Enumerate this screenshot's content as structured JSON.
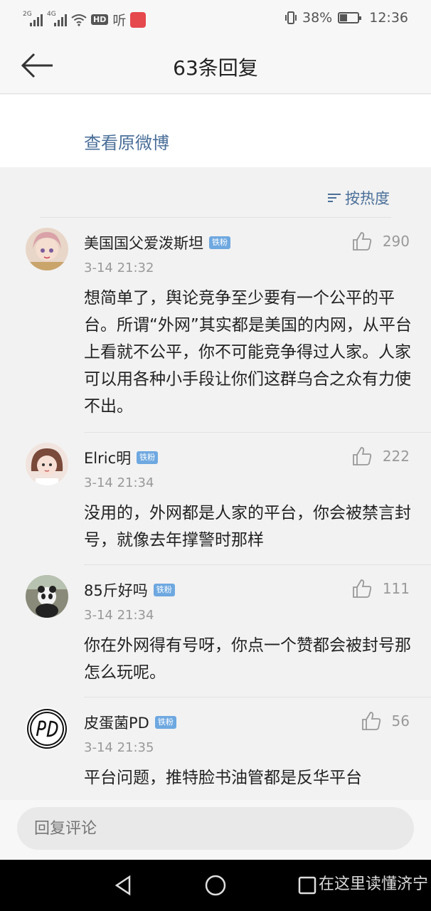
{
  "status_bar": {
    "net1": "2G",
    "net2": "4G",
    "hd": "HD",
    "listen": "听",
    "battery": "38%",
    "time": "12:36"
  },
  "header": {
    "title": "63条回复"
  },
  "original_link": "查看原微博",
  "sort_label": "按热度",
  "comments": [
    {
      "user": "美国国父爱泼斯坦",
      "badge": "铁粉",
      "likes": "290",
      "time": "3-14 21:32",
      "text": "想简单了，舆论竞争至少要有一个公平的平台。所谓“外网”其实都是美国的内网，从平台上看就不公平，你不可能竞争得过人家。人家可以用各种小手段让你们这群乌合之众有力使不出。"
    },
    {
      "user": "Elric明",
      "badge": "铁粉",
      "likes": "222",
      "time": "3-14 21:34",
      "text": "没用的，外网都是人家的平台，你会被禁言封号，就像去年撑警时那样"
    },
    {
      "user": "85斤好吗",
      "badge": "铁粉",
      "likes": "111",
      "time": "3-14 21:34",
      "text": "你在外网得有号呀，你点一个赞都会被封号那怎么玩呢。"
    },
    {
      "user": "皮蛋菌PD",
      "badge": "铁粉",
      "likes": "56",
      "time": "3-14 21:35",
      "text": "平台问题，推特脸书油管都是反华平台"
    }
  ],
  "reply_input": {
    "placeholder": "回复评论"
  },
  "watermark": "在这里读懂济宁",
  "colors": {
    "link": "#4a6f99",
    "badge": "#6ea8e0"
  }
}
